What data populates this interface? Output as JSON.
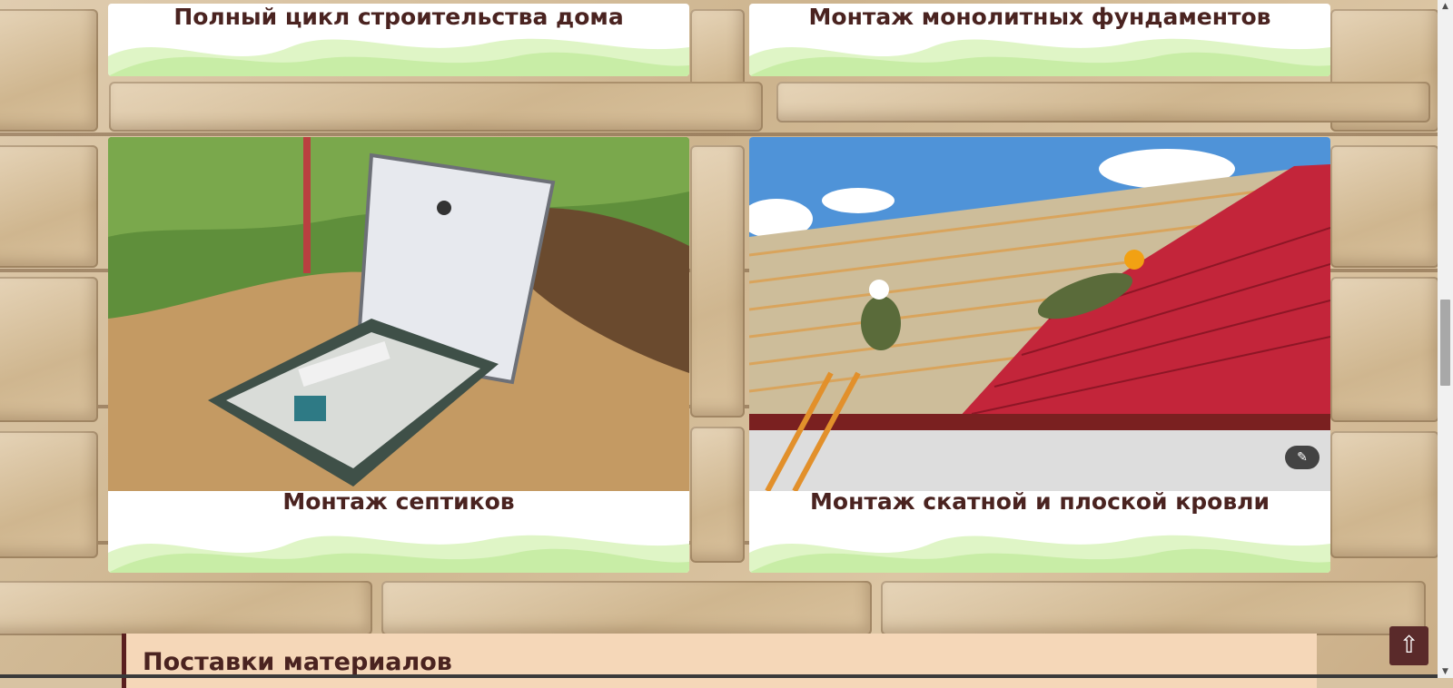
{
  "cards": [
    {
      "title": "Полный цикл строительства дома"
    },
    {
      "title": "Монтаж монолитных фундаментов"
    },
    {
      "title": "Монтаж септиков"
    },
    {
      "title": "Монтаж скатной и плоской кровли"
    }
  ],
  "supply_section": {
    "heading": "Поставки материалов"
  },
  "scroll_top": {
    "icon": "up-arrow-icon",
    "glyph": "⇧"
  },
  "image_tool": {
    "icon": "magic-wand-icon",
    "glyph": "✎"
  },
  "colors": {
    "title": "#4a2320",
    "supply_bg": "#f5d7b8",
    "accent": "#5a2a2a"
  }
}
